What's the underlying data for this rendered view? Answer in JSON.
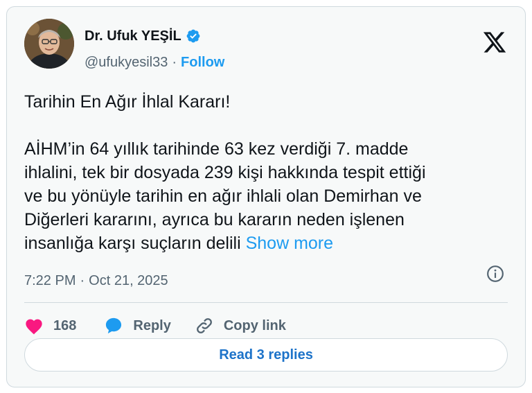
{
  "author": {
    "display_name": "Dr. Ufuk YEŞİL",
    "handle": "@ufukyesil33",
    "separator": "·",
    "follow_label": "Follow"
  },
  "tweet": {
    "title_line": "Tarihin En Ağır İhlal Kararı!",
    "lines": [
      "AİHM’in 64 yıllık tarihinde 63 kez verdiği 7. madde",
      "ihlalini, tek bir dosyada 239 kişi hakkında tespit ettiği",
      "ve bu yönüyle tarihin en ağır ihlali olan Demirhan ve",
      "Diğerleri kararını, ayrıca bu kararın neden işlenen",
      "insanlığa karşı suçların delili "
    ],
    "show_more_label": "Show more"
  },
  "meta": {
    "time": "7:22 PM",
    "separator": "·",
    "date": "Oct 21, 2025"
  },
  "actions": {
    "like_count": "168",
    "reply_label": "Reply",
    "copy_link_label": "Copy link"
  },
  "replies_button_label": "Read 3 replies",
  "colors": {
    "accent": "#1d9bf0",
    "like": "#f91880",
    "text": "#0f1419",
    "muted": "#536471"
  },
  "icons": [
    "verified-badge-icon",
    "x-logo-icon",
    "info-icon",
    "heart-icon",
    "reply-bubble-icon",
    "link-icon"
  ]
}
